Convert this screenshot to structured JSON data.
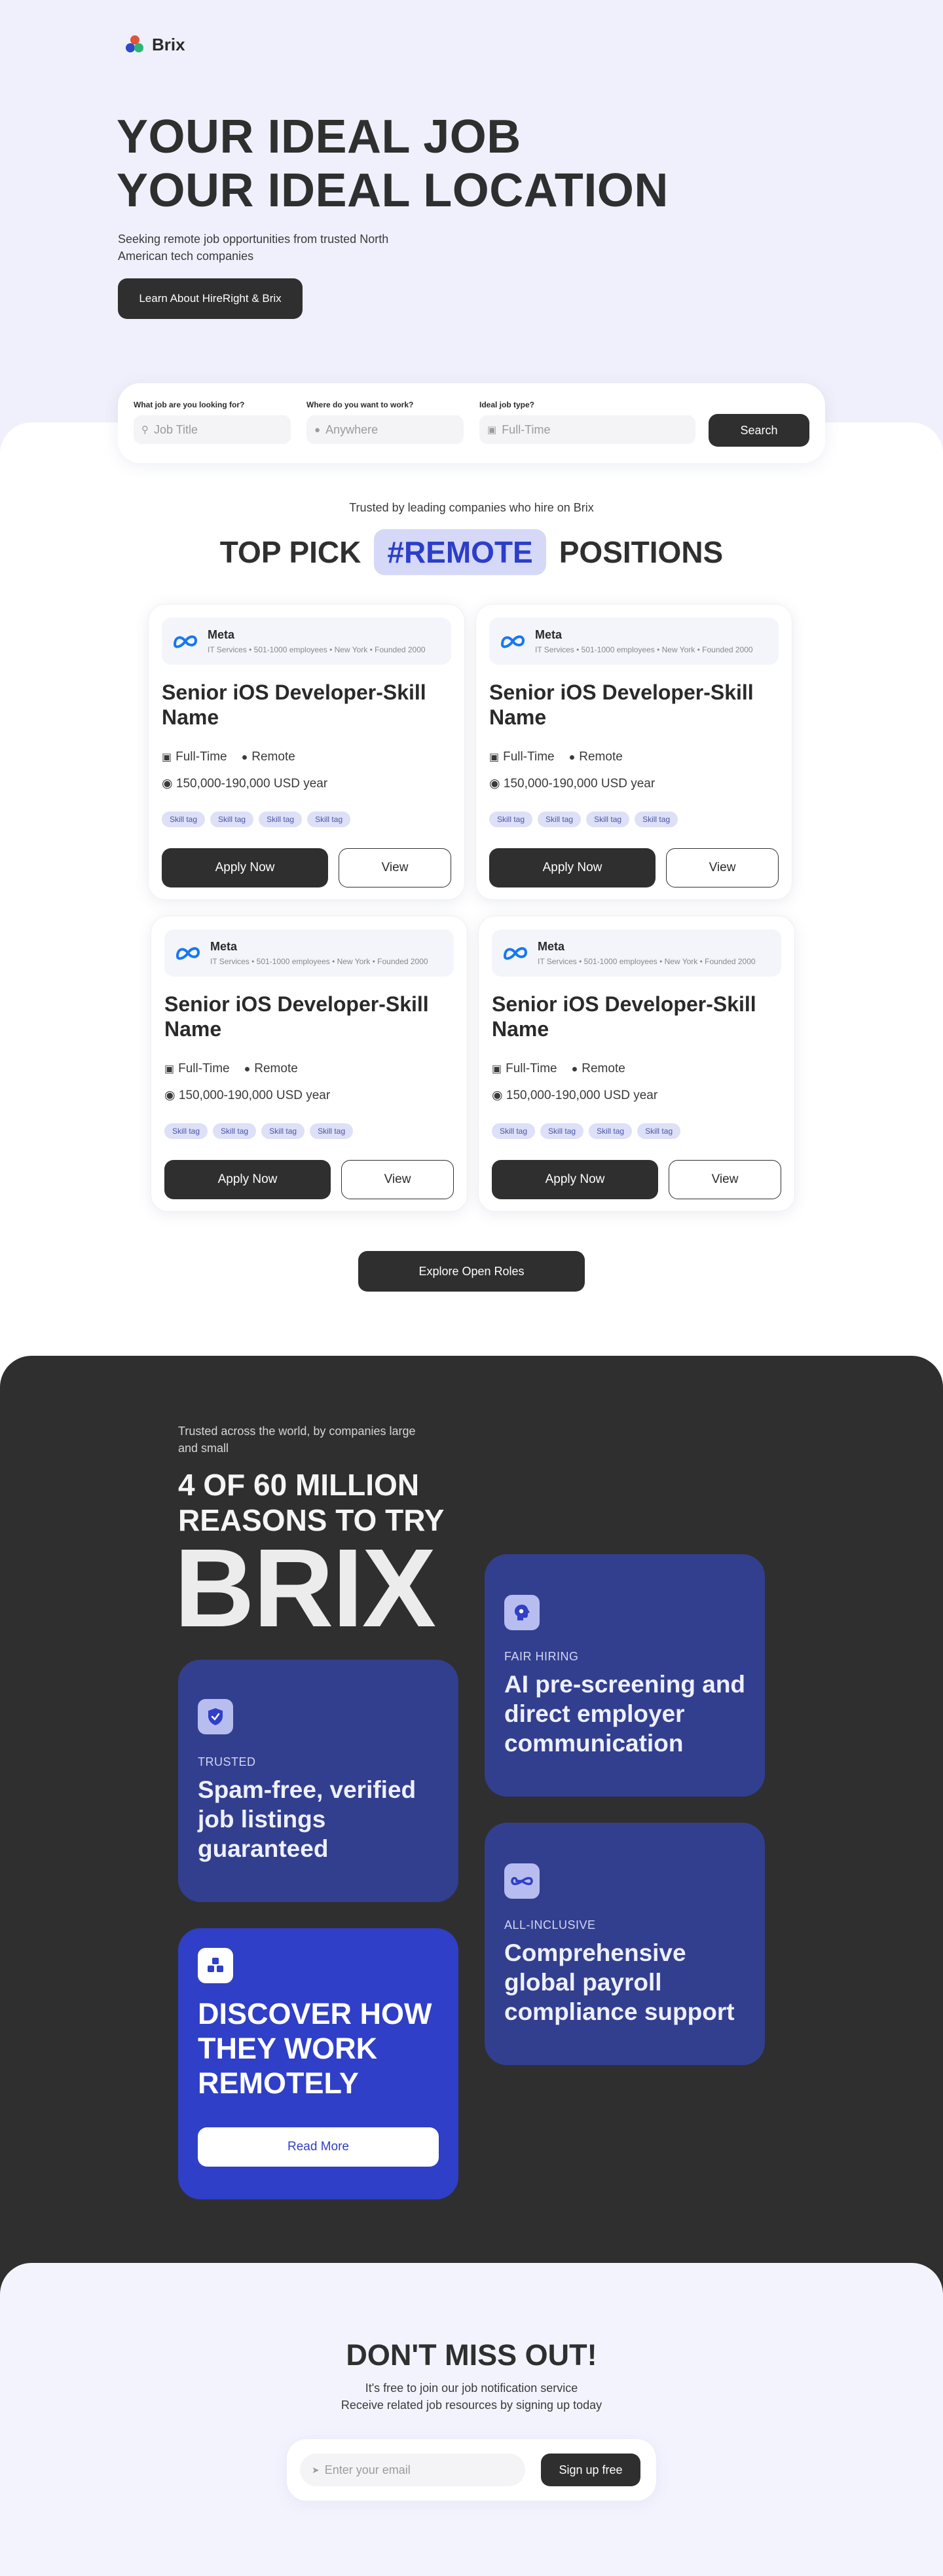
{
  "brand": {
    "name": "Brix"
  },
  "hero": {
    "title_line1": "YOUR IDEAL JOB",
    "title_line2": "YOUR IDEAL LOCATION",
    "subtitle": "Seeking  remote job opportunities from trusted North American tech companies",
    "cta_label": "Learn About HireRight & Brix"
  },
  "search": {
    "job_label": "What job are you looking for?",
    "job_placeholder": "Job Title",
    "location_label": "Where do you want to work?",
    "location_placeholder": "Anywhere",
    "type_label": "Ideal job type?",
    "type_placeholder": "Full-Time",
    "button_label": "Search"
  },
  "picks": {
    "trusted_text": "Trusted by leading companies who hire on Brix",
    "title_left": "TOP PICK",
    "title_highlight": "#REMOTE",
    "title_right": "POSITIONS",
    "jobs": [
      {
        "company": "Meta",
        "company_info": "IT Services • 501-1000 employees • New York • Founded 2000",
        "title": "Senior iOS Developer-Skill Name",
        "type": "Full-Time",
        "location": "Remote",
        "salary": "150,000-190,000 USD year",
        "tags": [
          "Skill tag",
          "Skill tag",
          "Skill tag",
          "Skill tag"
        ],
        "apply_label": "Apply Now",
        "view_label": "View"
      },
      {
        "company": "Meta",
        "company_info": "IT Services • 501-1000 employees • New York • Founded 2000",
        "title": "Senior iOS Developer-Skill Name",
        "type": "Full-Time",
        "location": "Remote",
        "salary": "150,000-190,000 USD year",
        "tags": [
          "Skill tag",
          "Skill tag",
          "Skill tag",
          "Skill tag"
        ],
        "apply_label": "Apply Now",
        "view_label": "View"
      },
      {
        "company": "Meta",
        "company_info": "IT Services • 501-1000 employees • New York • Founded 2000",
        "title": "Senior iOS Developer-Skill Name",
        "type": "Full-Time",
        "location": "Remote",
        "salary": "150,000-190,000 USD year",
        "tags": [
          "Skill tag",
          "Skill tag",
          "Skill tag",
          "Skill tag"
        ],
        "apply_label": "Apply Now",
        "view_label": "View"
      },
      {
        "company": "Meta",
        "company_info": "IT Services • 501-1000 employees • New York • Founded 2000",
        "title": "Senior iOS Developer-Skill Name",
        "type": "Full-Time",
        "location": "Remote",
        "salary": "150,000-190,000 USD year",
        "tags": [
          "Skill tag",
          "Skill tag",
          "Skill tag",
          "Skill tag"
        ],
        "apply_label": "Apply Now",
        "view_label": "View"
      }
    ],
    "explore_label": "Explore Open Roles"
  },
  "reasons": {
    "kicker": "Trusted across the world, by companies large and small",
    "title_line1": "4 OF 60 MILLION",
    "title_line2": "REASONS TO TRY",
    "brand_big": "BRIX",
    "features": [
      {
        "kicker": "FAIR HIRING",
        "headline": "AI pre-screening and direct employer communication",
        "icon": "brain-icon"
      },
      {
        "kicker": "TRUSTED",
        "headline": "Spam-free, verified job listings guaranteed",
        "icon": "shield-check-icon"
      },
      {
        "kicker": "ALL-INCLUSIVE",
        "headline": "Comprehensive global payroll compliance support",
        "icon": "infinity-icon"
      }
    ],
    "discover": {
      "headline": "DISCOVER HOW THEY WORK REMOTELY",
      "button_label": "Read More",
      "icon": "cubes-icon"
    }
  },
  "newsletter": {
    "title": "DON'T MISS OUT!",
    "line1": "It's free to join our job notification service",
    "line2": "Receive related job resources by signing up today",
    "email_placeholder": "Enter your email",
    "button_label": "Sign up free"
  },
  "colors": {
    "hero_bg": "#eff0fb",
    "dark_bg": "#2f2f2f",
    "accent_blue": "#2f3fc7",
    "feature_card": "#323f8f",
    "pill_bg": "#d5d8f7"
  }
}
